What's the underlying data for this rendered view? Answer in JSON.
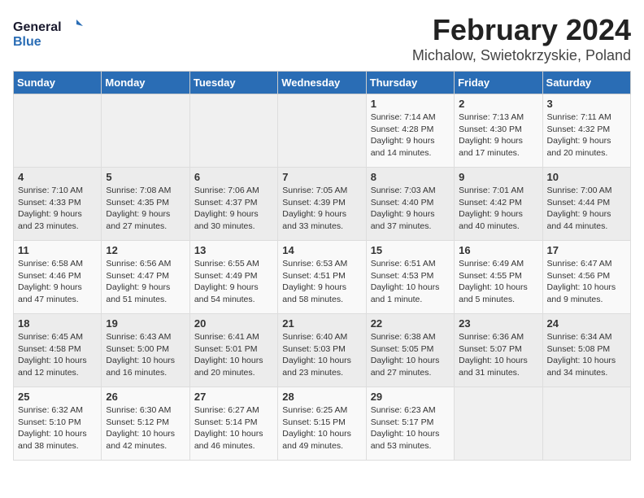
{
  "logo": {
    "line1": "General",
    "line2": "Blue"
  },
  "header": {
    "title": "February 2024",
    "subtitle": "Michalow, Swietokrzyskie, Poland"
  },
  "weekdays": [
    "Sunday",
    "Monday",
    "Tuesday",
    "Wednesday",
    "Thursday",
    "Friday",
    "Saturday"
  ],
  "weeks": [
    [
      {
        "day": "",
        "info": ""
      },
      {
        "day": "",
        "info": ""
      },
      {
        "day": "",
        "info": ""
      },
      {
        "day": "",
        "info": ""
      },
      {
        "day": "1",
        "info": "Sunrise: 7:14 AM\nSunset: 4:28 PM\nDaylight: 9 hours\nand 14 minutes."
      },
      {
        "day": "2",
        "info": "Sunrise: 7:13 AM\nSunset: 4:30 PM\nDaylight: 9 hours\nand 17 minutes."
      },
      {
        "day": "3",
        "info": "Sunrise: 7:11 AM\nSunset: 4:32 PM\nDaylight: 9 hours\nand 20 minutes."
      }
    ],
    [
      {
        "day": "4",
        "info": "Sunrise: 7:10 AM\nSunset: 4:33 PM\nDaylight: 9 hours\nand 23 minutes."
      },
      {
        "day": "5",
        "info": "Sunrise: 7:08 AM\nSunset: 4:35 PM\nDaylight: 9 hours\nand 27 minutes."
      },
      {
        "day": "6",
        "info": "Sunrise: 7:06 AM\nSunset: 4:37 PM\nDaylight: 9 hours\nand 30 minutes."
      },
      {
        "day": "7",
        "info": "Sunrise: 7:05 AM\nSunset: 4:39 PM\nDaylight: 9 hours\nand 33 minutes."
      },
      {
        "day": "8",
        "info": "Sunrise: 7:03 AM\nSunset: 4:40 PM\nDaylight: 9 hours\nand 37 minutes."
      },
      {
        "day": "9",
        "info": "Sunrise: 7:01 AM\nSunset: 4:42 PM\nDaylight: 9 hours\nand 40 minutes."
      },
      {
        "day": "10",
        "info": "Sunrise: 7:00 AM\nSunset: 4:44 PM\nDaylight: 9 hours\nand 44 minutes."
      }
    ],
    [
      {
        "day": "11",
        "info": "Sunrise: 6:58 AM\nSunset: 4:46 PM\nDaylight: 9 hours\nand 47 minutes."
      },
      {
        "day": "12",
        "info": "Sunrise: 6:56 AM\nSunset: 4:47 PM\nDaylight: 9 hours\nand 51 minutes."
      },
      {
        "day": "13",
        "info": "Sunrise: 6:55 AM\nSunset: 4:49 PM\nDaylight: 9 hours\nand 54 minutes."
      },
      {
        "day": "14",
        "info": "Sunrise: 6:53 AM\nSunset: 4:51 PM\nDaylight: 9 hours\nand 58 minutes."
      },
      {
        "day": "15",
        "info": "Sunrise: 6:51 AM\nSunset: 4:53 PM\nDaylight: 10 hours\nand 1 minute."
      },
      {
        "day": "16",
        "info": "Sunrise: 6:49 AM\nSunset: 4:55 PM\nDaylight: 10 hours\nand 5 minutes."
      },
      {
        "day": "17",
        "info": "Sunrise: 6:47 AM\nSunset: 4:56 PM\nDaylight: 10 hours\nand 9 minutes."
      }
    ],
    [
      {
        "day": "18",
        "info": "Sunrise: 6:45 AM\nSunset: 4:58 PM\nDaylight: 10 hours\nand 12 minutes."
      },
      {
        "day": "19",
        "info": "Sunrise: 6:43 AM\nSunset: 5:00 PM\nDaylight: 10 hours\nand 16 minutes."
      },
      {
        "day": "20",
        "info": "Sunrise: 6:41 AM\nSunset: 5:01 PM\nDaylight: 10 hours\nand 20 minutes."
      },
      {
        "day": "21",
        "info": "Sunrise: 6:40 AM\nSunset: 5:03 PM\nDaylight: 10 hours\nand 23 minutes."
      },
      {
        "day": "22",
        "info": "Sunrise: 6:38 AM\nSunset: 5:05 PM\nDaylight: 10 hours\nand 27 minutes."
      },
      {
        "day": "23",
        "info": "Sunrise: 6:36 AM\nSunset: 5:07 PM\nDaylight: 10 hours\nand 31 minutes."
      },
      {
        "day": "24",
        "info": "Sunrise: 6:34 AM\nSunset: 5:08 PM\nDaylight: 10 hours\nand 34 minutes."
      }
    ],
    [
      {
        "day": "25",
        "info": "Sunrise: 6:32 AM\nSunset: 5:10 PM\nDaylight: 10 hours\nand 38 minutes."
      },
      {
        "day": "26",
        "info": "Sunrise: 6:30 AM\nSunset: 5:12 PM\nDaylight: 10 hours\nand 42 minutes."
      },
      {
        "day": "27",
        "info": "Sunrise: 6:27 AM\nSunset: 5:14 PM\nDaylight: 10 hours\nand 46 minutes."
      },
      {
        "day": "28",
        "info": "Sunrise: 6:25 AM\nSunset: 5:15 PM\nDaylight: 10 hours\nand 49 minutes."
      },
      {
        "day": "29",
        "info": "Sunrise: 6:23 AM\nSunset: 5:17 PM\nDaylight: 10 hours\nand 53 minutes."
      },
      {
        "day": "",
        "info": ""
      },
      {
        "day": "",
        "info": ""
      }
    ]
  ]
}
